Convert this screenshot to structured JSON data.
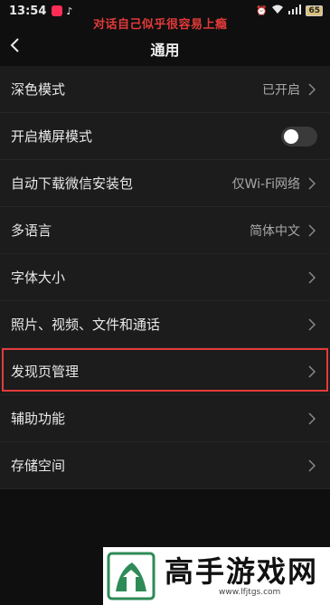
{
  "status_bar": {
    "time": "13:54",
    "battery": "65"
  },
  "overlay_caption": "对话自己似乎很容易上瘾",
  "nav": {
    "title": "通用"
  },
  "settings": [
    {
      "label": "深色模式",
      "value": "已开启",
      "type": "link"
    },
    {
      "label": "开启横屏模式",
      "type": "toggle",
      "on": false
    },
    {
      "label": "自动下载微信安装包",
      "value": "仅Wi-Fi网络",
      "type": "link"
    },
    {
      "label": "多语言",
      "value": "简体中文",
      "type": "link"
    },
    {
      "label": "字体大小",
      "type": "link"
    },
    {
      "label": "照片、视频、文件和通话",
      "type": "link"
    },
    {
      "label": "发现页管理",
      "type": "link",
      "highlighted": true
    },
    {
      "label": "辅助功能",
      "type": "link"
    },
    {
      "label": "存储空间",
      "type": "link"
    }
  ],
  "watermark": {
    "title": "高手游戏网",
    "url": "www.lfjtgs.com"
  },
  "colors": {
    "highlight": "#e43b3b",
    "background": "#0f0f0f",
    "list_bg": "#1c1c1c"
  },
  "icons": {
    "back": "chevron-left-icon",
    "row_arrow": "chevron-right-icon"
  }
}
